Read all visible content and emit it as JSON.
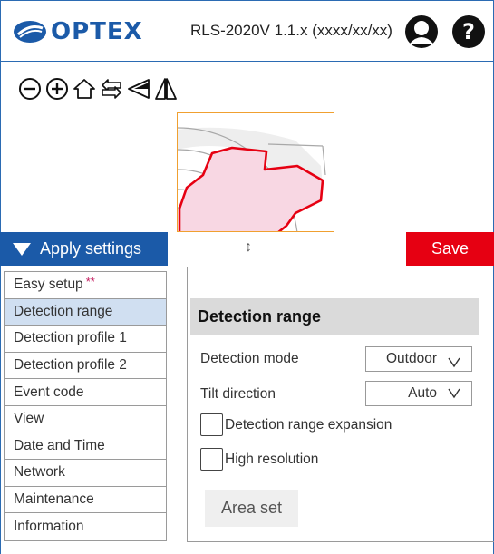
{
  "header": {
    "logo_text": "OPTEX",
    "device_title": "RLS-2020V 1.1.x (xxxx/xx/xx)",
    "user_icon": "user-account-icon",
    "help_icon": "help-question-icon"
  },
  "toolbar": {
    "icons": [
      "zoom-out-icon",
      "zoom-in-icon",
      "home-icon",
      "swap-arrows-icon",
      "triangle-left-icon",
      "mirror-icon"
    ]
  },
  "actions": {
    "apply_label": "Apply settings",
    "handle_glyph": "↕",
    "save_label": "Save"
  },
  "sidebar": {
    "items": [
      {
        "label": "Easy setup",
        "suffix": "**"
      },
      {
        "label": "Detection range",
        "active": true
      },
      {
        "label": "Detection profile 1"
      },
      {
        "label": "Detection profile 2"
      },
      {
        "label": "Event code"
      },
      {
        "label": "View"
      },
      {
        "label": "Date and Time"
      },
      {
        "label": "Network"
      },
      {
        "label": "Maintenance"
      },
      {
        "label": "Information"
      }
    ]
  },
  "panel": {
    "title": "Detection range",
    "detection_mode_label": "Detection mode",
    "detection_mode_value": "Outdoor",
    "tilt_direction_label": "Tilt direction",
    "tilt_direction_value": "Auto",
    "expansion_label": "Detection range expansion",
    "expansion_checked": false,
    "high_res_label": "High resolution",
    "high_res_checked": false,
    "area_set_label": "Area set"
  },
  "colors": {
    "brand_blue": "#1b5aa8",
    "save_red": "#e60012",
    "active_item": "#d0dff1",
    "zone_fill": "#f8d7e3",
    "zone_stroke": "#e60012"
  }
}
